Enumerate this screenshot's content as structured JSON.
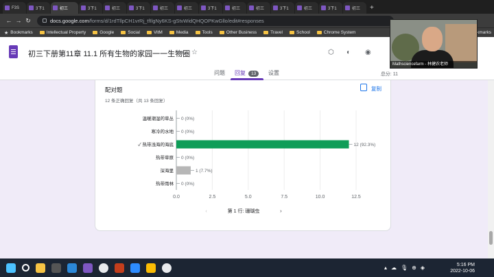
{
  "browser": {
    "tabs": [
      "F3S",
      "3下1",
      "初三",
      "3下1",
      "初三",
      "3下1",
      "初三",
      "初三",
      "3下1",
      "初三",
      "初三",
      "3下1",
      "初三",
      "3下1",
      "初三"
    ],
    "url_host": "docs.google.com",
    "url_path": "/forms/d/1rdTllpCH1vrRj_tfIlgNy6KS-gStvWidQHQOPKwGllo/edit#responses",
    "bookmarks": [
      "Bookmarks",
      "Intellectual Property",
      "Google",
      "Social",
      "VitM",
      "Media",
      "Tools",
      "Other Business",
      "Travel",
      "School",
      "Chrome System"
    ],
    "bookmarks_overflow": "okmarks"
  },
  "form": {
    "title": "初三下册第11章 11.1 所有生物的家园一一生物圈",
    "tabs": [
      "问题",
      "回复",
      "设置"
    ],
    "responses_count": "13",
    "score_label": "总分:",
    "score_value": "11"
  },
  "question": {
    "title": "配对题",
    "subtitle": "12 条正确回复（共 13 条回复）",
    "copy_label": "复制",
    "pager_label": "第 1 行:",
    "pager_value": "珊瑚虫"
  },
  "chart_data": {
    "type": "bar",
    "orientation": "horizontal",
    "categories": [
      "温暖潮湿的草丛",
      "寒冷的水地",
      "✓ 热带浅海的海底",
      "热带草原",
      "深海里",
      "热带雨林"
    ],
    "values": [
      0,
      0,
      12,
      0,
      1,
      0
    ],
    "data_labels": [
      "0 (0%)",
      "0 (0%)",
      "12 (92.3%)",
      "0 (0%)",
      "1 (7.7%)",
      "0 (0%)"
    ],
    "x_ticks": [
      "0.0",
      "2.5",
      "5.0",
      "7.5",
      "10.0",
      "12.5"
    ],
    "xlim": [
      0,
      12.5
    ],
    "grid": true,
    "colors": {
      "correct": "#0f9d58",
      "incorrect": "#b7b7b7",
      "zero_line": "#dadce0"
    }
  },
  "webcam": {
    "label": "Mathsciencefarm - 林健农老师"
  },
  "taskbar": {
    "time": "5:16 PM",
    "date": "2022-10-06"
  }
}
